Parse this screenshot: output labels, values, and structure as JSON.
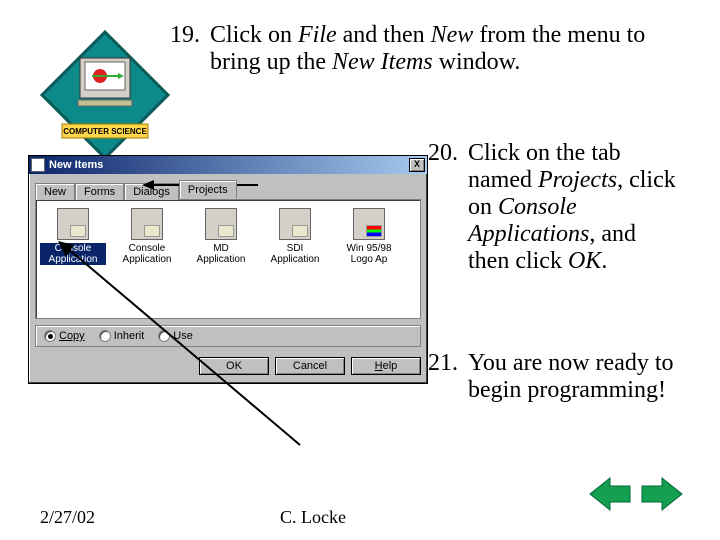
{
  "logo": {
    "banner": "COMPUTER SCIENCE"
  },
  "instructions": [
    {
      "n": "19.",
      "pre": "Click on ",
      "em1": "File",
      "mid": " and then ",
      "em2": "New",
      "post": " from the menu to bring up the ",
      "em3": "New Items",
      "end": " window."
    },
    {
      "n": "20.",
      "pre": "Click on the tab named ",
      "em1": "Projects",
      "mid": ", click on ",
      "em2": "Console Applications",
      "post": ", and then click ",
      "em3": "OK",
      "end": "."
    },
    {
      "n": "21.",
      "text": "You are now ready to begin programming!"
    }
  ],
  "window": {
    "title": "New Items",
    "close": "X",
    "tabs": [
      "New",
      "Forms",
      "Dialogs",
      "Projects"
    ],
    "active_tab": 3,
    "items": [
      {
        "label": "Console Application",
        "selected": true
      },
      {
        "label": "Console Application",
        "selected": false
      },
      {
        "label": "MD Application",
        "selected": false
      },
      {
        "label": "SDI Application",
        "selected": false
      },
      {
        "label": "Win 95/98 Logo Ap",
        "selected": false
      }
    ],
    "radios": [
      {
        "label": "Copy",
        "checked": true
      },
      {
        "label": "Inherit",
        "checked": false
      },
      {
        "label": "Use",
        "checked": false
      }
    ],
    "buttons": {
      "ok": "OK",
      "cancel": "Cancel",
      "help": "Help"
    }
  },
  "footer": {
    "date": "2/27/02",
    "author": "C. Locke"
  }
}
